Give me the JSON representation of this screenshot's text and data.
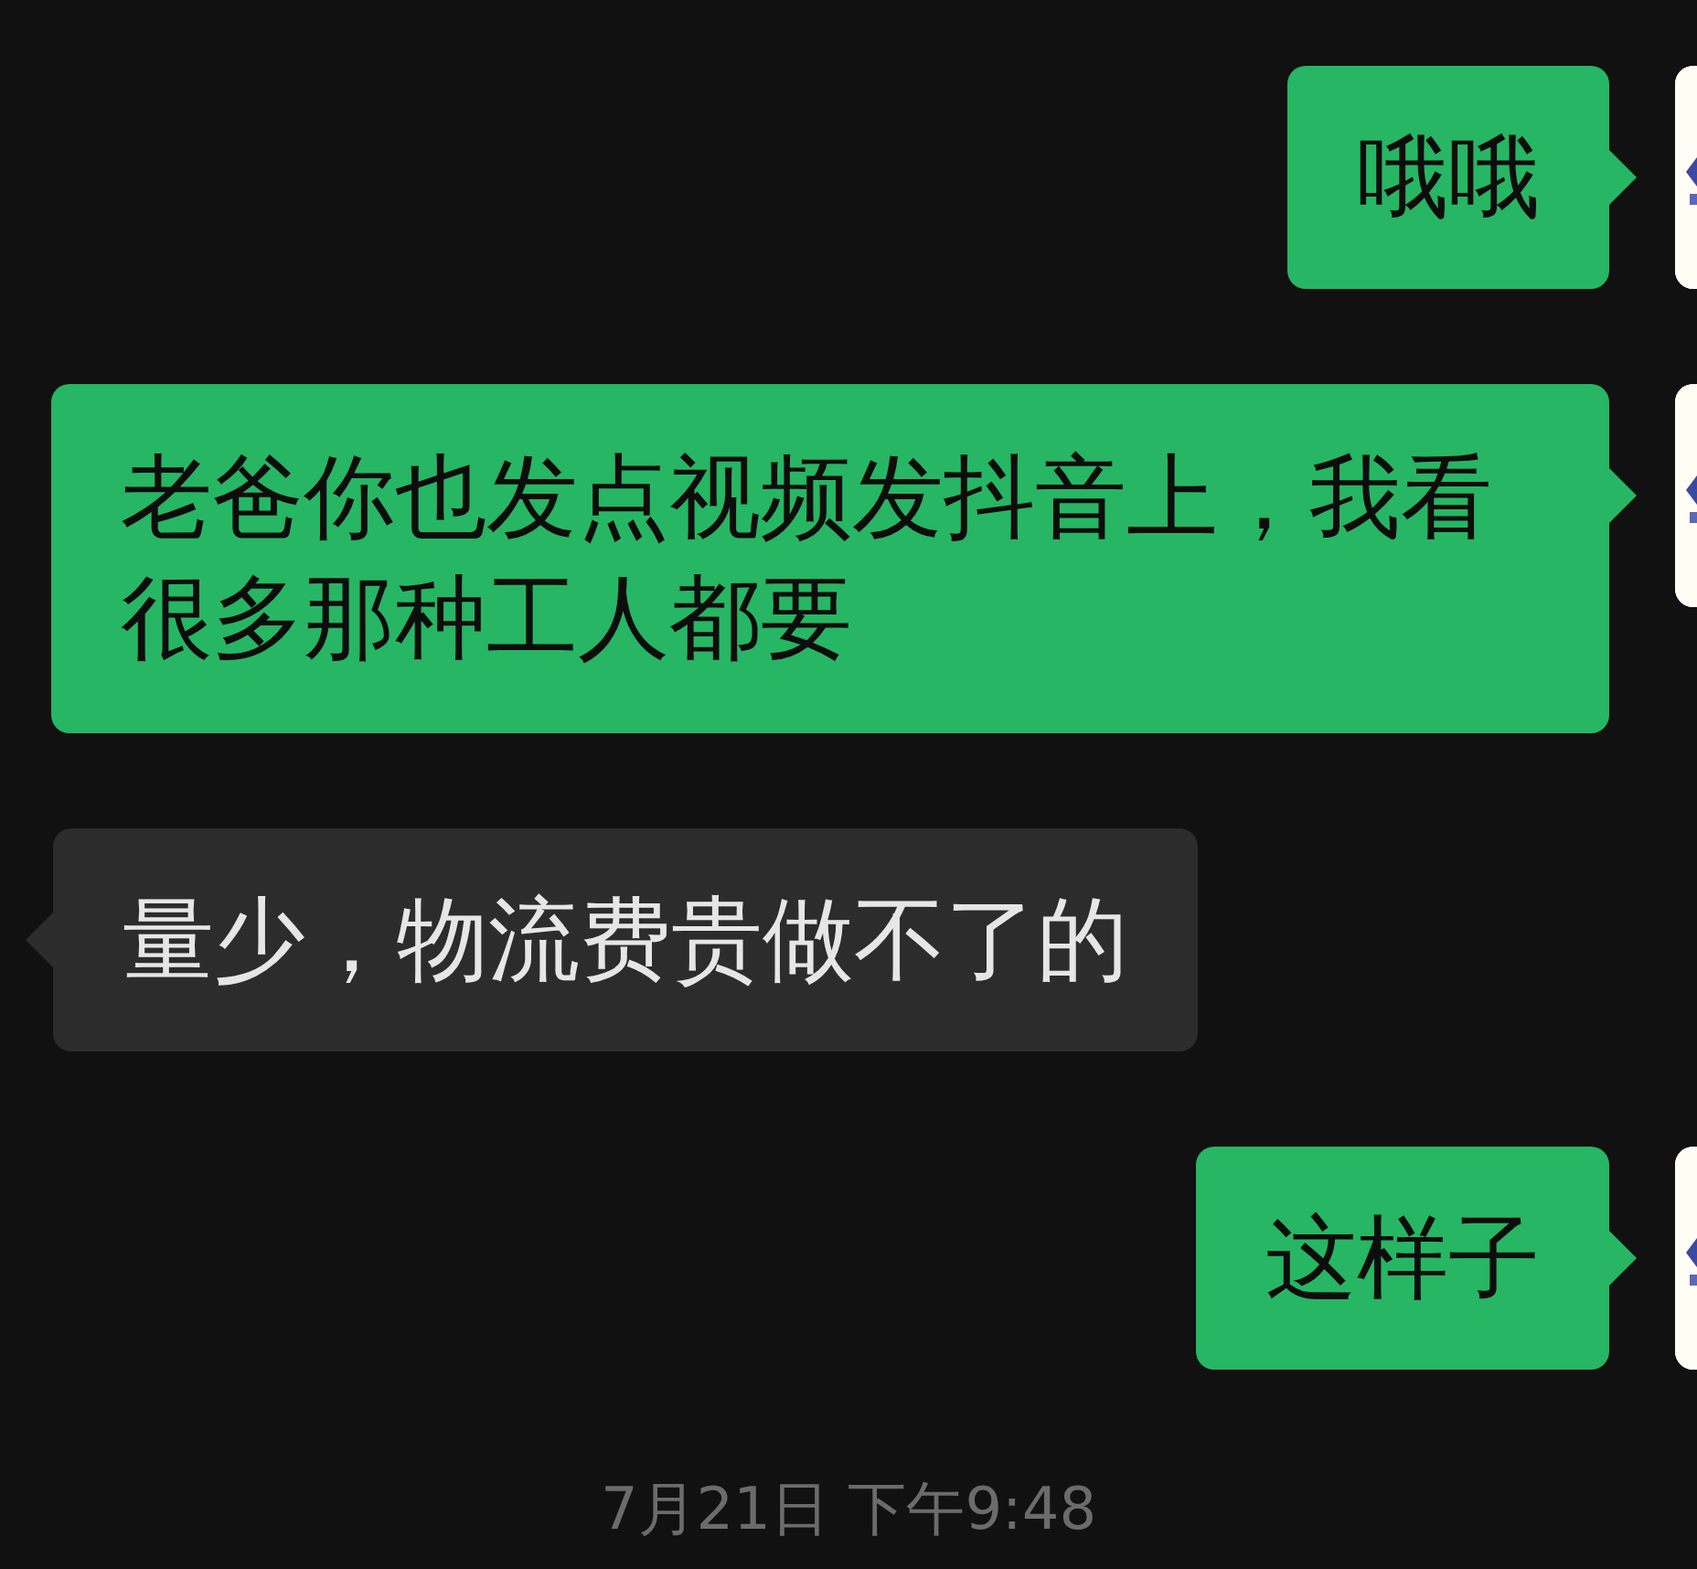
{
  "messages": [
    {
      "kind": "sent",
      "text": "哦哦"
    },
    {
      "kind": "sent",
      "text": "老爸你也发点视频发抖音上，我看很多那种工人都要"
    },
    {
      "kind": "received",
      "text": "量少，物流费贵做不了的"
    },
    {
      "kind": "sent",
      "text": "这样子"
    }
  ],
  "timestamp": "7月21日 下午9:48"
}
